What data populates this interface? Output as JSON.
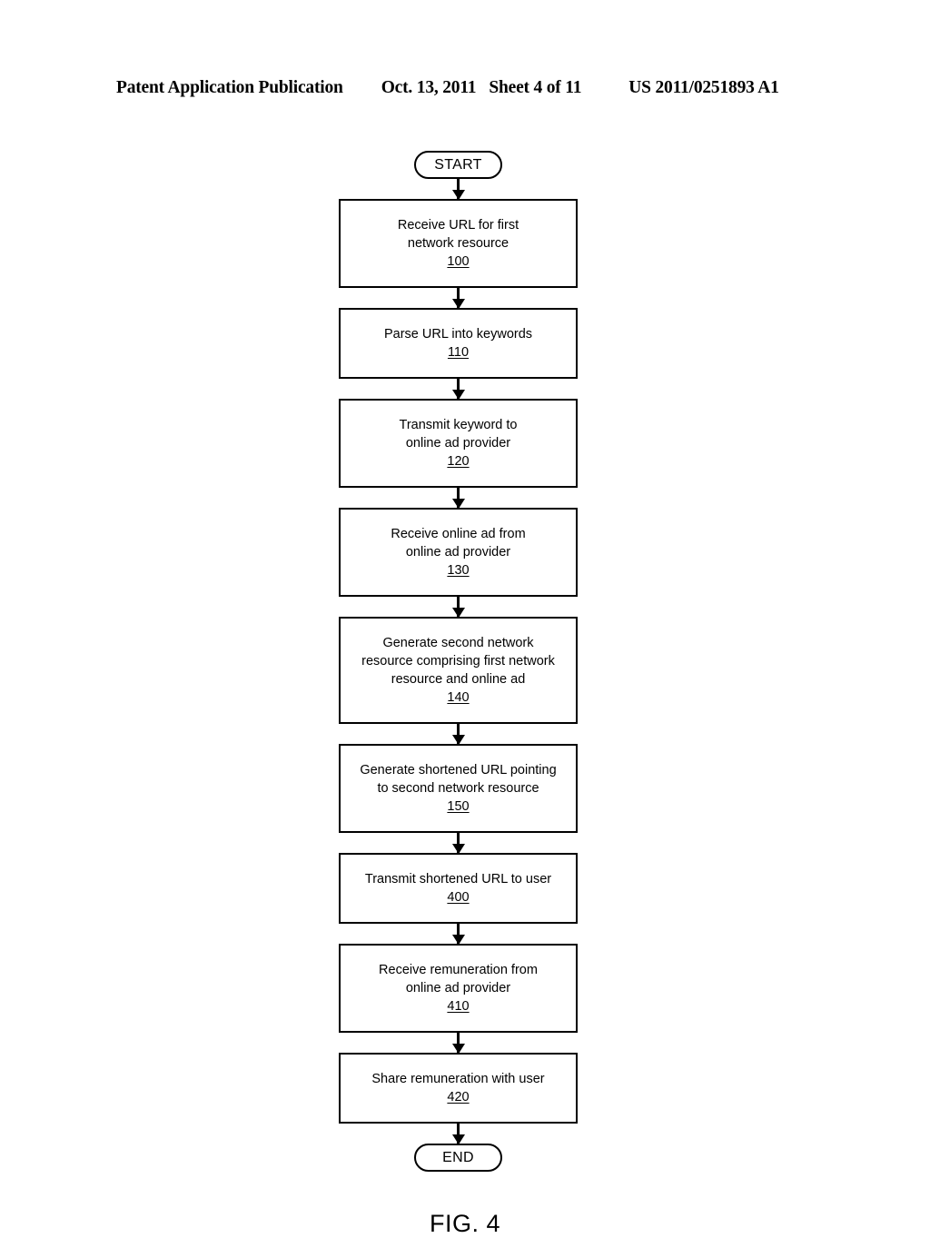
{
  "header": {
    "publication": "Patent Application Publication",
    "date": "Oct. 13, 2011",
    "sheet": "Sheet 4 of 11",
    "publication_number": "US 2011/0251893 A1"
  },
  "figure": {
    "caption": "FIG. 4",
    "type": "flowchart",
    "orientation": "vertical-single-column"
  },
  "flowchart": {
    "start": {
      "label": "START"
    },
    "end": {
      "label": "END"
    },
    "steps": [
      {
        "id": "step-100",
        "ref": "100",
        "lines": [
          "Receive URL for first",
          "network resource"
        ]
      },
      {
        "id": "step-110",
        "ref": "110",
        "lines": [
          "Parse URL into keywords"
        ]
      },
      {
        "id": "step-120",
        "ref": "120",
        "lines": [
          "Transmit keyword to",
          "online ad provider"
        ]
      },
      {
        "id": "step-130",
        "ref": "130",
        "lines": [
          "Receive online ad from",
          "online ad provider"
        ]
      },
      {
        "id": "step-140",
        "ref": "140",
        "lines": [
          "Generate second network",
          "resource comprising first network",
          "resource and online ad"
        ]
      },
      {
        "id": "step-150",
        "ref": "150",
        "lines": [
          "Generate shortened URL pointing",
          "to second network resource"
        ]
      },
      {
        "id": "step-400",
        "ref": "400",
        "lines": [
          "Transmit shortened URL to user"
        ]
      },
      {
        "id": "step-410",
        "ref": "410",
        "lines": [
          "Receive remuneration from",
          "online ad provider"
        ]
      },
      {
        "id": "step-420",
        "ref": "420",
        "lines": [
          "Share remuneration with user"
        ]
      }
    ]
  },
  "colors": {
    "ink": "#000000",
    "paper": "#ffffff"
  }
}
